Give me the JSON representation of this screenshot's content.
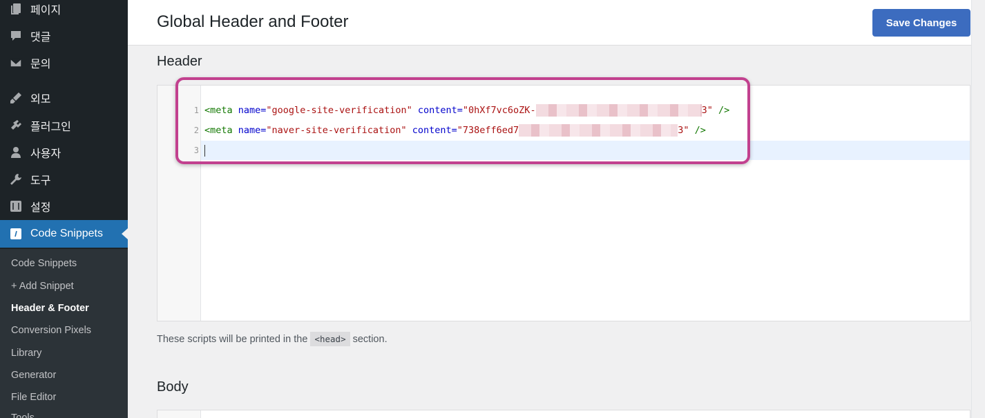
{
  "sidebar": {
    "items": [
      {
        "label": "페이지",
        "icon": "pages-icon"
      },
      {
        "label": "댓글",
        "icon": "comments-icon"
      },
      {
        "label": "문의",
        "icon": "mail-icon"
      },
      {
        "label": "외모",
        "icon": "brush-icon"
      },
      {
        "label": "플러그인",
        "icon": "plugin-icon"
      },
      {
        "label": "사용자",
        "icon": "user-icon"
      },
      {
        "label": "도구",
        "icon": "wrench-icon"
      },
      {
        "label": "설정",
        "icon": "settings-icon"
      },
      {
        "label": "Code Snippets",
        "icon": "code-icon"
      }
    ],
    "submenu": [
      "Code Snippets",
      "+ Add Snippet",
      "Header & Footer",
      "Conversion Pixels",
      "Library",
      "Generator",
      "File Editor",
      "Tools"
    ]
  },
  "header": {
    "title": "Global Header and Footer",
    "save_label": "Save Changes"
  },
  "header_section": {
    "title": "Header",
    "lines": [
      {
        "num": "1",
        "tag_open": "<meta ",
        "attr1": "name=",
        "val1": "\"google-site-verification\"",
        "attr2": " content=",
        "val2_start": "\"0hXf7vc6oZK-",
        "val2_end": "3\"",
        "tag_close": " />"
      },
      {
        "num": "2",
        "tag_open": "<meta ",
        "attr1": "name=",
        "val1": "\"naver-site-verification\"",
        "attr2": " content=",
        "val2_start": "\"738eff6ed7",
        "val2_end": "3\"",
        "tag_close": " />"
      },
      {
        "num": "3"
      }
    ],
    "hint_before": "These scripts will be printed in the ",
    "hint_code": "<head>",
    "hint_after": " section."
  },
  "body_section": {
    "title": "Body"
  },
  "colors": {
    "accent": "#2271b1",
    "save_button": "#3c6cbf",
    "highlight": "#c2418f"
  }
}
